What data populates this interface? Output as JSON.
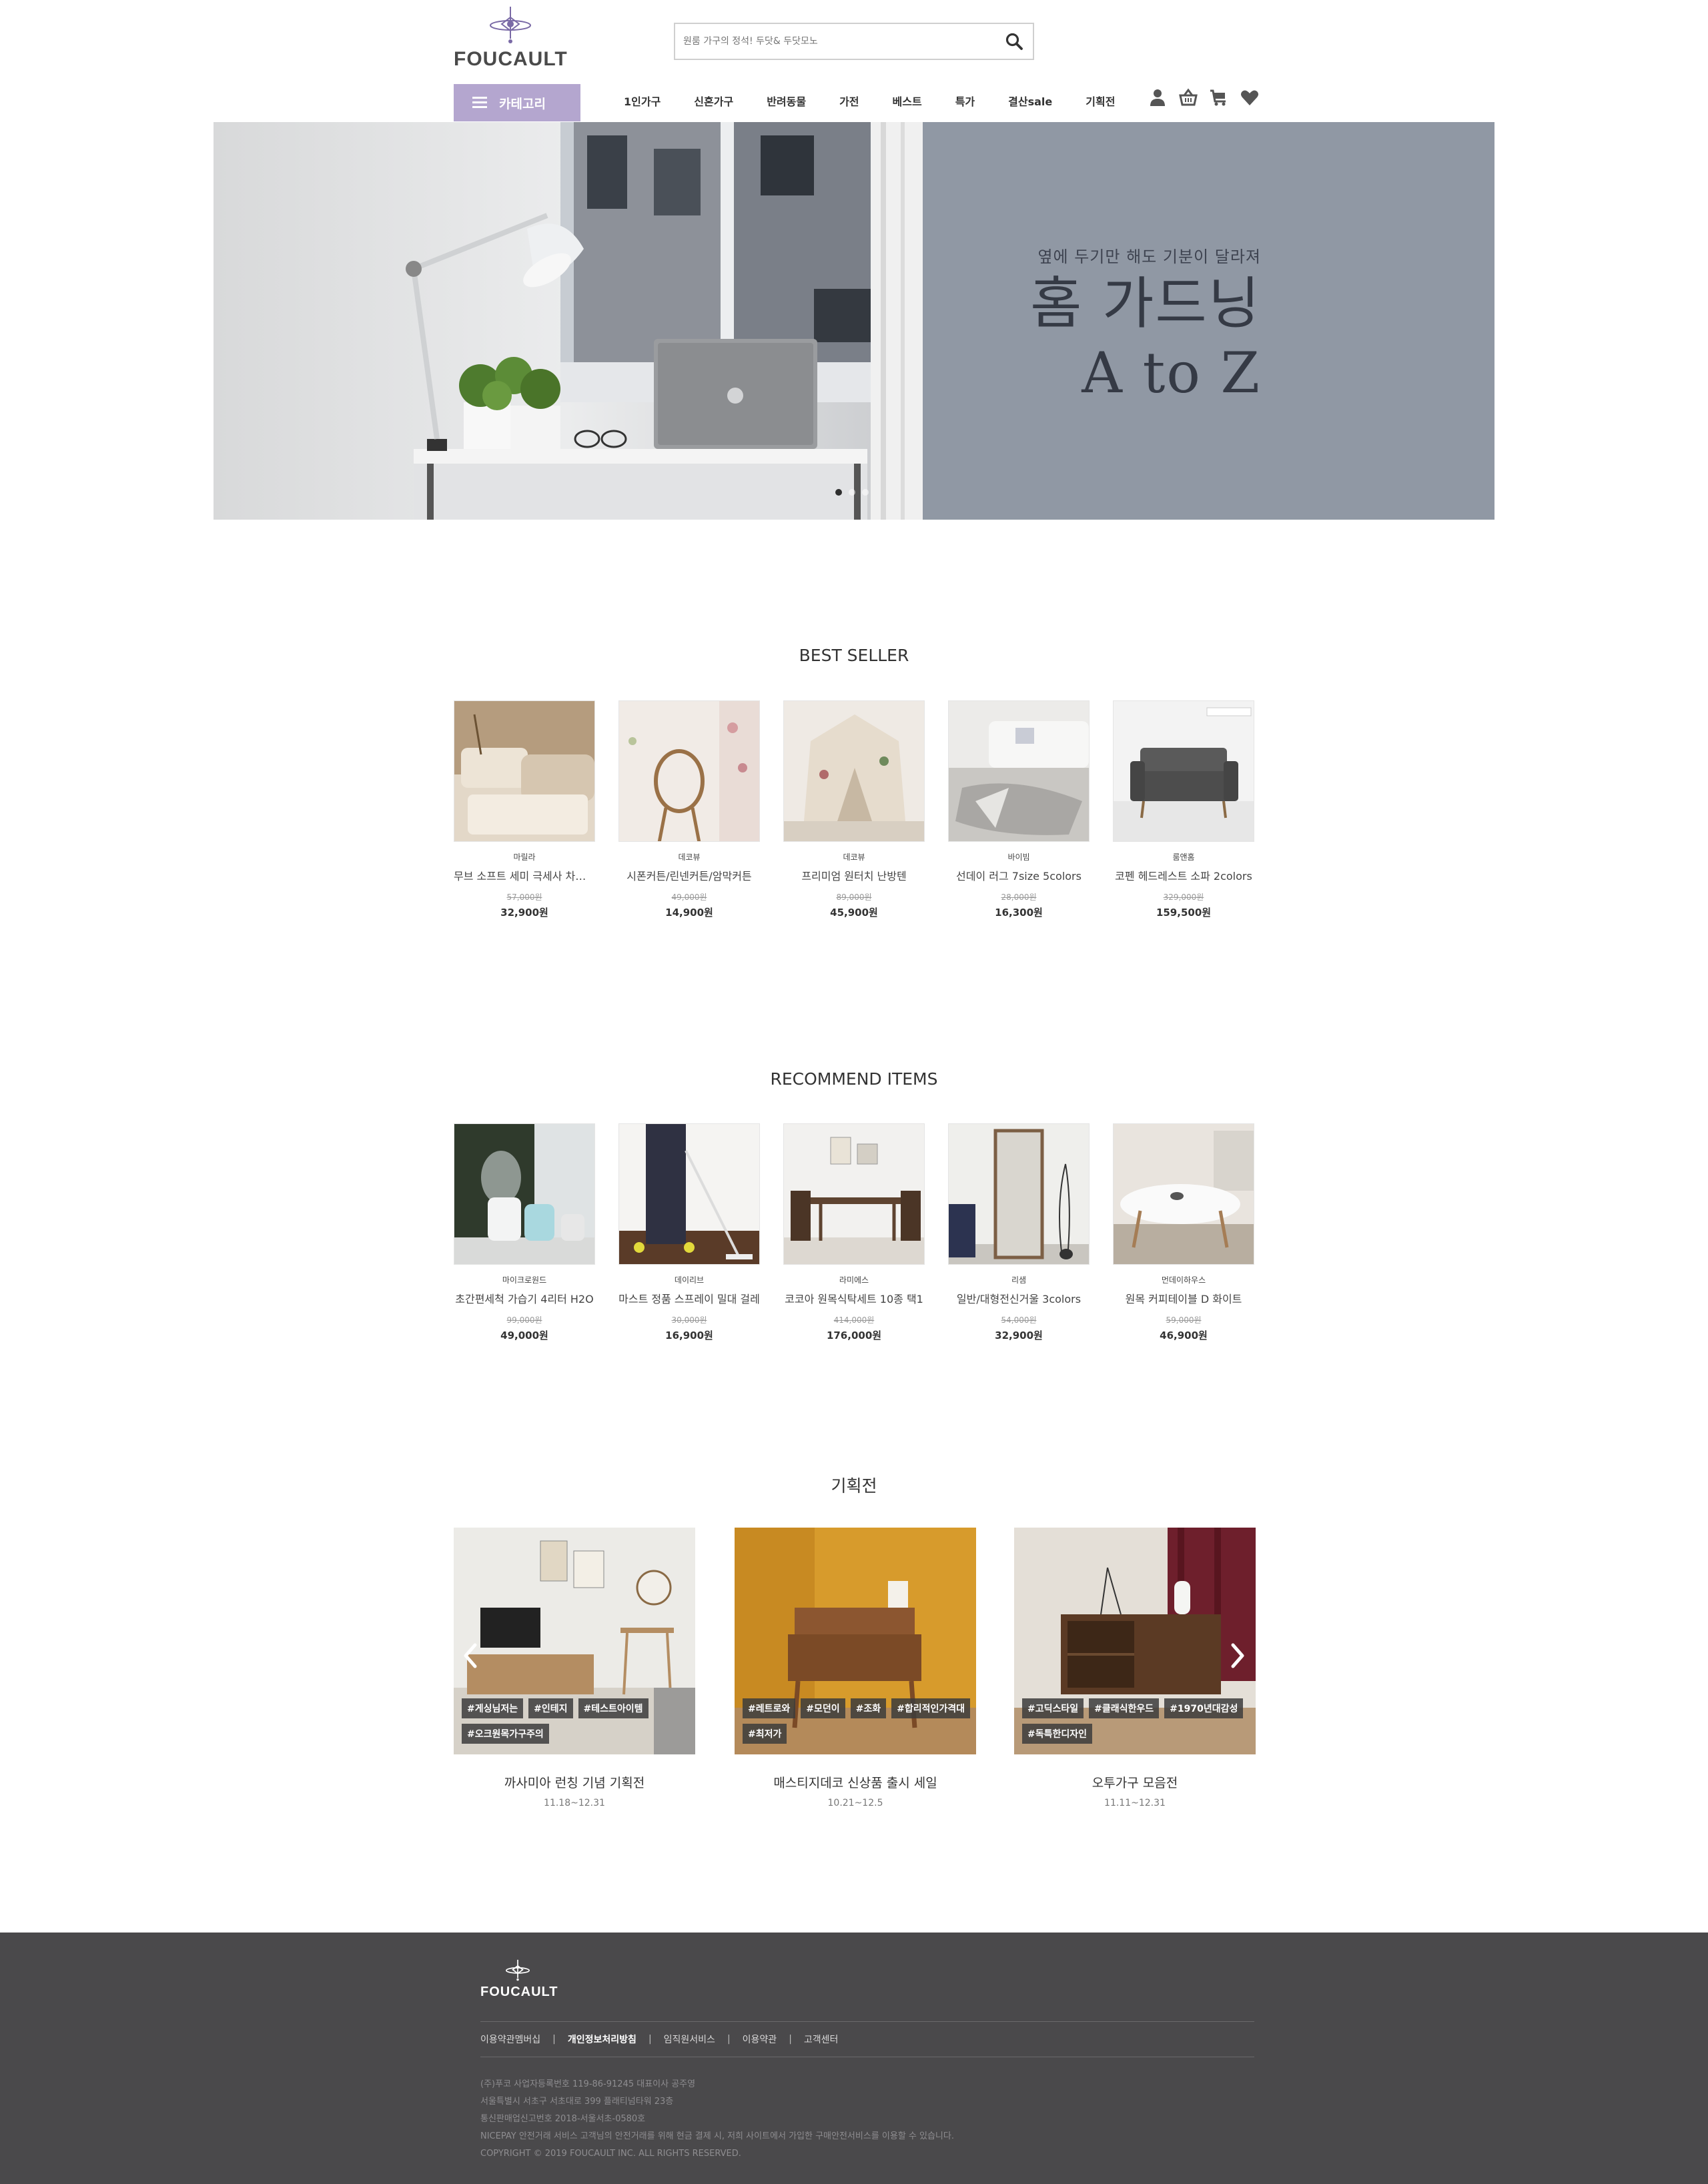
{
  "header": {
    "logo_text": "FOUCAULT",
    "search_placeholder": "원룸 가구의 정석! 두닷& 두닷모노",
    "category_label": "카테고리",
    "nav": [
      "1인가구",
      "신혼가구",
      "반려동물",
      "가전",
      "베스트",
      "특가",
      "결산sale",
      "기획전"
    ],
    "util_icons": [
      "user-icon",
      "basket-icon",
      "cart-icon",
      "heart-icon"
    ]
  },
  "hero": {
    "subtitle": "옆에 두기만 해도 기분이 달라져",
    "title_line1": "홈 가드닝",
    "title_line2": "A to Z",
    "slides": 3,
    "active_slide": 1
  },
  "best_seller": {
    "title": "BEST SELLER",
    "items": [
      {
        "brand": "마릴라",
        "name": "무브 소프트 세미 극세사 차렵이불",
        "original_price": "57,000원",
        "price": "32,900원"
      },
      {
        "brand": "데코뷰",
        "name": "시폰커튼/린넨커튼/암막커튼",
        "original_price": "49,000원",
        "price": "14,900원"
      },
      {
        "brand": "데코뷰",
        "name": "프리미엄 원터치 난방텐",
        "original_price": "89,000원",
        "price": "45,900원"
      },
      {
        "brand": "바이빔",
        "name": "선데이 러그 7size 5colors",
        "original_price": "28,000원",
        "price": "16,300원"
      },
      {
        "brand": "룸앤홈",
        "name": "코펜 헤드레스트 소파 2colors",
        "original_price": "329,000원",
        "price": "159,500원"
      }
    ]
  },
  "recommend": {
    "title": "RECOMMEND ITEMS",
    "items": [
      {
        "brand": "마이크로원드",
        "name": "초간편세척 가습기 4리터 H2O",
        "original_price": "99,000원",
        "price": "49,000원"
      },
      {
        "brand": "데이리브",
        "name": "마스트 정품 스프레이 밀대 걸레",
        "original_price": "30,000원",
        "price": "16,900원"
      },
      {
        "brand": "라미에스",
        "name": "코코아 원목식탁세트 10종 택1",
        "original_price": "414,000원",
        "price": "176,000원"
      },
      {
        "brand": "리샘",
        "name": "일반/대형전신거울 3colors",
        "original_price": "54,000원",
        "price": "32,900원"
      },
      {
        "brand": "먼데이하우스",
        "name": "원목 커피테이블 D 화이트",
        "original_price": "59,000원",
        "price": "46,900원"
      }
    ]
  },
  "planned": {
    "title": "기획전",
    "items": [
      {
        "title": "까사미아 런칭 기념 기획전",
        "date": "11.18~12.31",
        "tags": [
          "#게싱님저는",
          "#인테지",
          "#테스트아이템",
          "#오크원목가구주의"
        ]
      },
      {
        "title": "매스티지데코 신상품 출시 세일",
        "date": "10.21~12.5",
        "tags": [
          "#레트로와",
          "#모던이",
          "#조화",
          "#합리적인가격대",
          "#최저가"
        ]
      },
      {
        "title": "오투가구 모음전",
        "date": "11.11~12.31",
        "tags": [
          "#고딕스타일",
          "#클래식한우드",
          "#1970년대감성",
          "#독특한디자인"
        ]
      }
    ]
  },
  "footer": {
    "logo_text": "FOUCAULT",
    "links": [
      "이용약관멤버십",
      "개인정보처리방침",
      "임직원서비스",
      "이용약관",
      "고객센터"
    ],
    "info": [
      "(주)푸코    사업자등록번호 119-86-91245    대표이사 공주영",
      "서울특별시 서초구 서초대로 399 플래티넘타워 23층",
      "통신판매업신고번호    2018-서울서초-0580호",
      "NICEPAY 안전거래 서비스 고객님의 안전거래를 위해 현금 결제 시, 저희 사이트에서 가입한 구매안전서비스를 이용할 수 있습니다.",
      "COPYRIGHT © 2019 FOUCAULT INC. ALL RIGHTS RESERVED."
    ]
  },
  "colors": {
    "accent": "#b4a6cf",
    "hero_bg": "#9098a4",
    "footer_bg": "#4a494b"
  }
}
